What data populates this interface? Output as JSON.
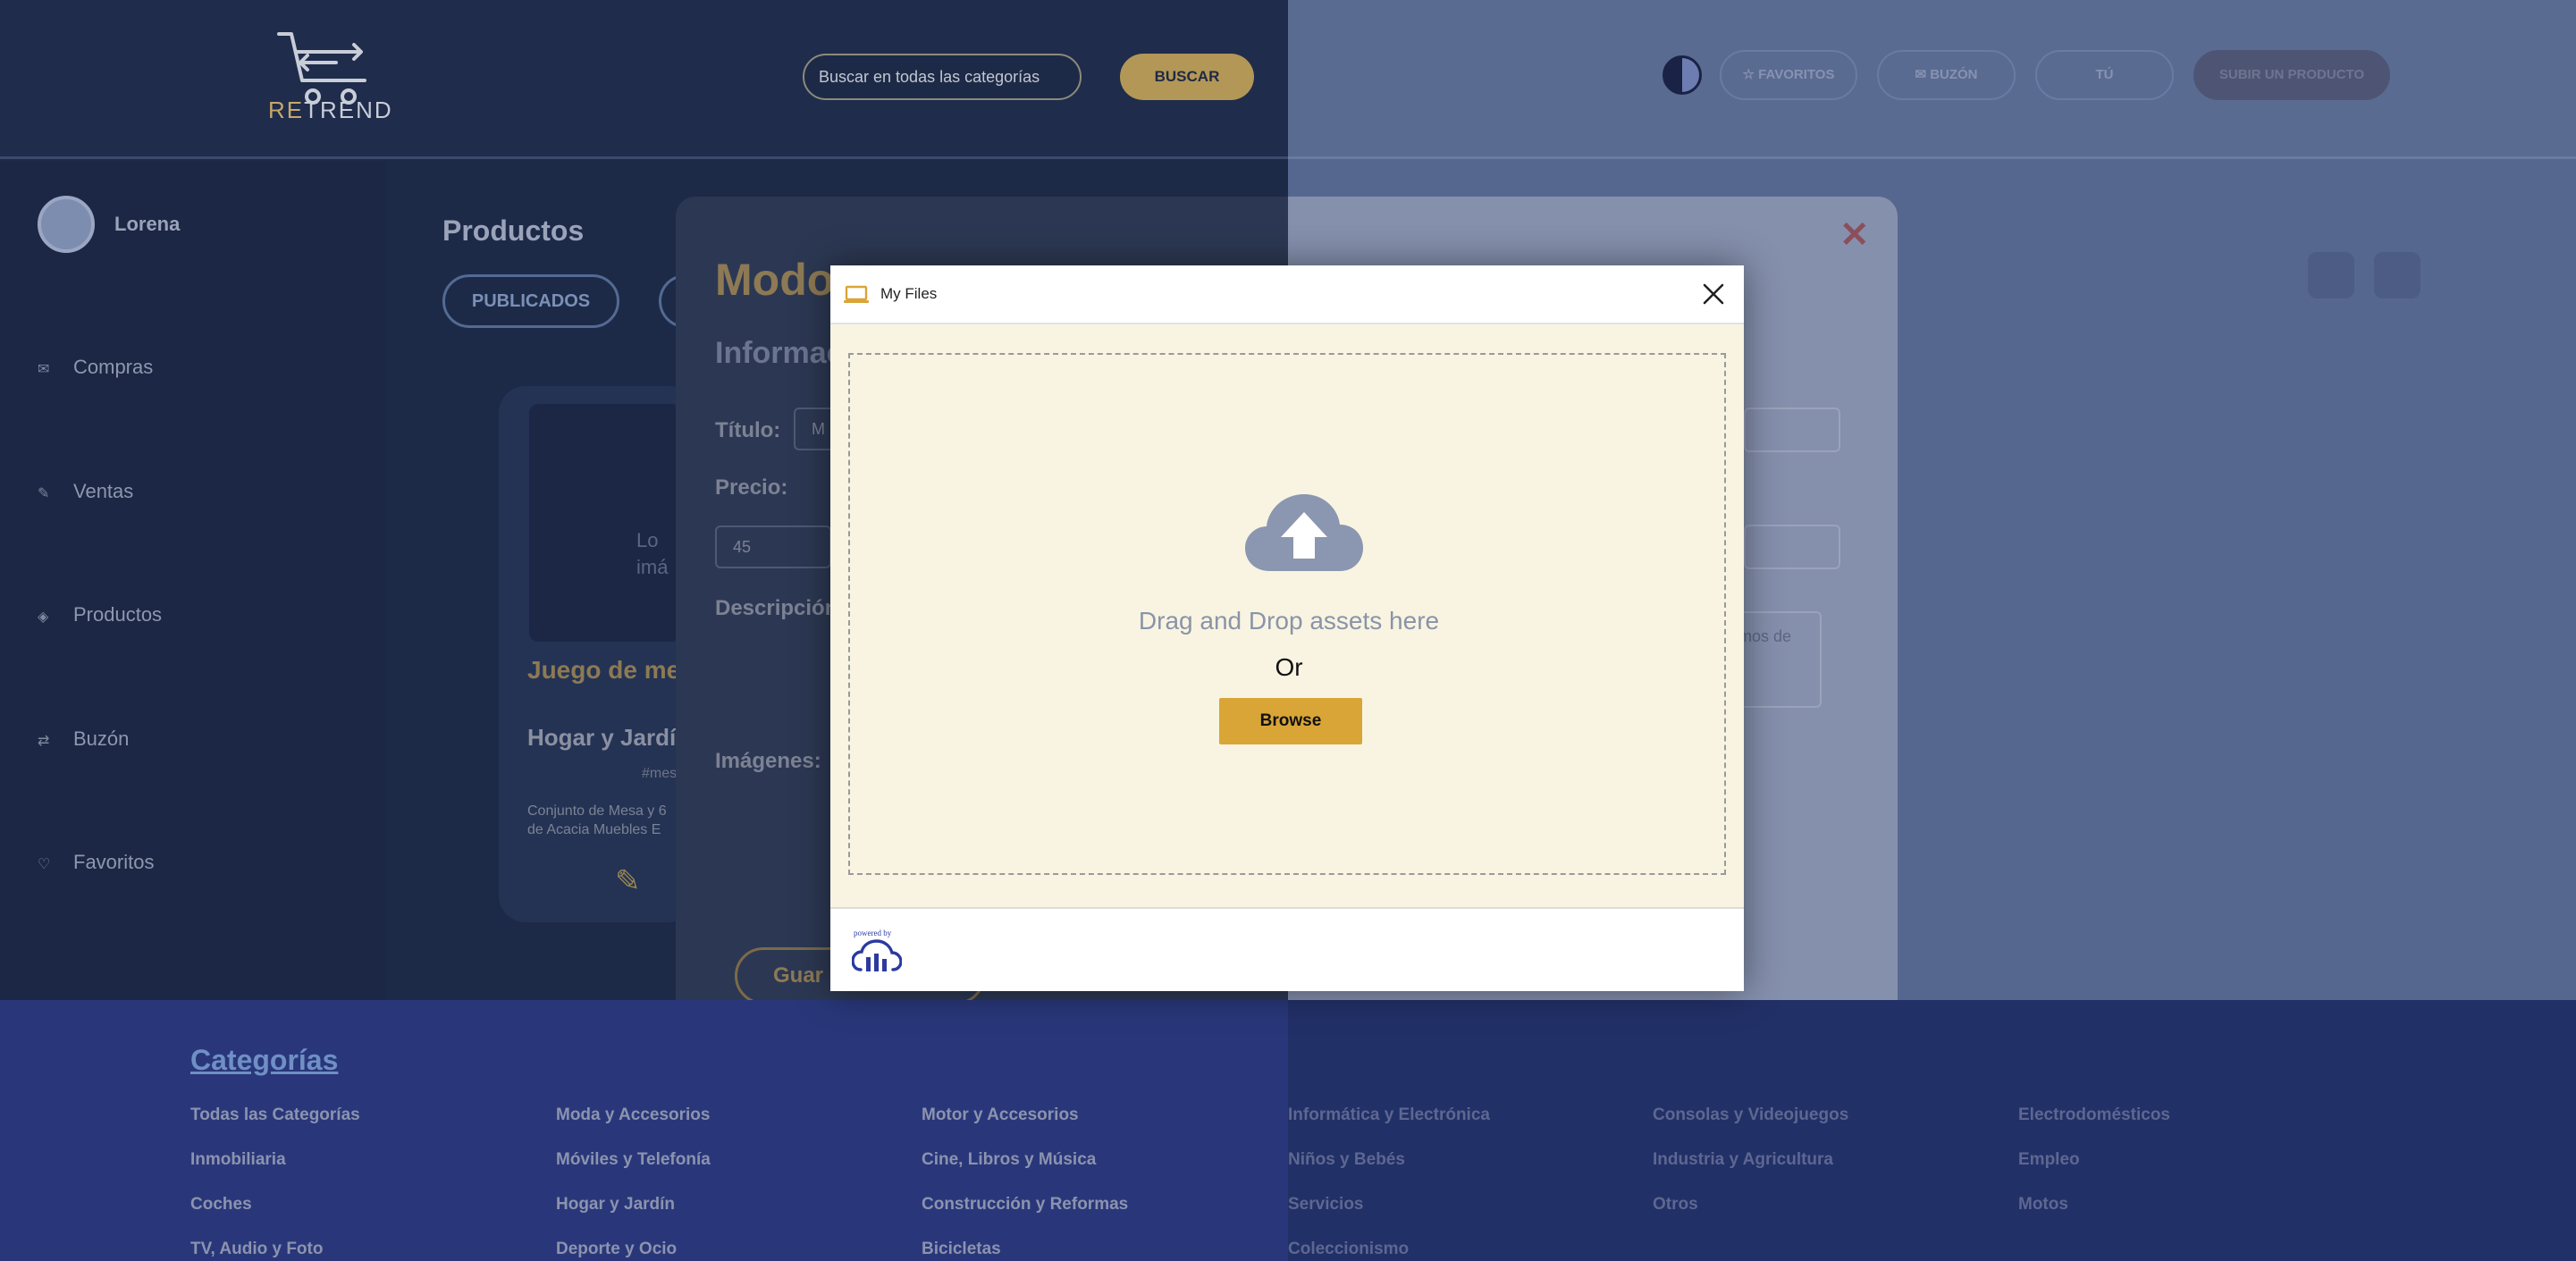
{
  "brand": {
    "logo_text_re": "RE",
    "logo_text_rest": "TREND"
  },
  "header": {
    "search_placeholder": "Buscar en todas las categorías",
    "search_button": "BUSCAR",
    "favoritos": "☆ FAVORITOS",
    "buzon": "✉ BUZÓN",
    "tu": "TÚ",
    "subir": "SUBIR UN PRODUCTO"
  },
  "sidebar": {
    "user": "Lorena",
    "items": [
      {
        "icon": "✉",
        "label": "Compras"
      },
      {
        "icon": "✎",
        "label": "Ventas"
      },
      {
        "icon": "◈",
        "label": "Productos"
      },
      {
        "icon": "⇄",
        "label": "Buzón"
      },
      {
        "icon": "♡",
        "label": "Favoritos"
      }
    ]
  },
  "main": {
    "title": "Productos",
    "tab_publicados": "PUBLICADOS"
  },
  "card": {
    "image_text": "Lo imá",
    "title": "Juego de mes jardín",
    "category": "Hogar y Jardín",
    "tag": "#mes",
    "description": "Conjunto de Mesa y 6 de Acacia Muebles E",
    "edit_icon": "✎"
  },
  "edit_dialog": {
    "heading": "Modo",
    "subheading": "Informac",
    "titulo_label": "Título:",
    "titulo_value": "M",
    "precio_label": "Precio:",
    "precio_value": "45",
    "descripcion_label": "Descripción:",
    "imagenes_label": "Imágenes:",
    "textarea_right": "n gamos de",
    "save_label": "Guar",
    "close_icon": "✕"
  },
  "footer": {
    "heading": "Categorías",
    "columns": [
      [
        "Todas las Categorías",
        "Inmobiliaria",
        "Coches",
        "TV, Audio y Foto"
      ],
      [
        "Moda y Accesorios",
        "Móviles y Telefonía",
        "Hogar y Jardín",
        "Deporte y Ocio"
      ],
      [
        "Motor y Accesorios",
        "Cine, Libros y Música",
        "Construcción y Reformas",
        "Bicicletas"
      ],
      [
        "Informática y Electrónica",
        "Niños y Bebés",
        "Servicios",
        "Coleccionismo"
      ],
      [
        "Consolas y Videojuegos",
        "Industria y Agricultura",
        "Otros"
      ],
      [
        "Electrodomésticos",
        "Empleo",
        "Motos"
      ]
    ]
  },
  "file_modal": {
    "title": "My Files",
    "drop_text": "Drag and Drop assets here",
    "or_text": "Or",
    "browse_label": "Browse",
    "powered_by": "powered by"
  },
  "colors": {
    "browse_button": "#d9a537",
    "dropzone_bg": "#f8f4e1",
    "accent_gold": "#b39757"
  }
}
